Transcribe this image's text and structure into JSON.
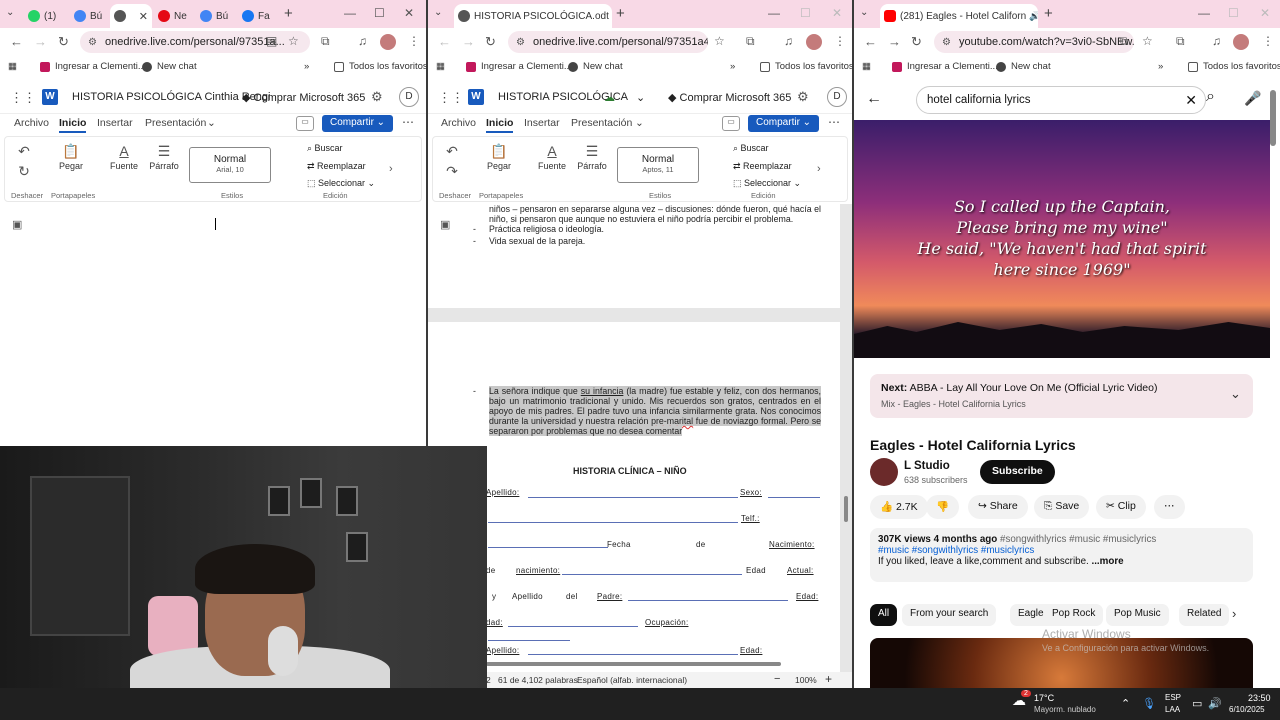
{
  "win1": {
    "tabs": [
      {
        "label": "(1)",
        "color": "#25d366"
      },
      {
        "label": "Bú",
        "color": "#4285f4"
      },
      {
        "label": "",
        "color": "#555555"
      },
      {
        "label": "Ne",
        "color": "#e50914"
      },
      {
        "label": "Bú",
        "color": "#4285f4"
      },
      {
        "label": "Fa",
        "color": "#1877f2"
      }
    ],
    "url": "onedrive.live.com/personal/97351a...",
    "bookmarks": [
      "Ingresar a Clementi...",
      "New chat",
      "Todos los favoritos"
    ],
    "doc_title": "HISTORIA PSICOLÓGICA Cinthia Rengi",
    "buy": "Comprar Microsoft 365",
    "avatar": "D",
    "ribbon_tabs": [
      "Archivo",
      "Inicio",
      "Insertar",
      "Presentación"
    ],
    "share": "Compartir",
    "undo_cap": "Deshacer",
    "paste": "Pegar",
    "clipboard_cap": "Portapapeles",
    "font": "Fuente",
    "paragraph": "Párrafo",
    "style_name": "Normal",
    "style_font": "Arial, 10",
    "styles_cap": "Estilos",
    "edit_items": [
      "Buscar",
      "Reemplazar",
      "Seleccionar"
    ],
    "edit_cap": "Edición"
  },
  "win2": {
    "tab_title": "HISTORIA PSICOLÓGICA.odt",
    "url": "onedrive.live.com/personal/97351a4aa3...",
    "bookmarks": [
      "Ingresar a Clementi...",
      "New chat",
      "Todos los favoritos"
    ],
    "doc_title": "HISTORIA PSICOLÓGICA",
    "buy": "Comprar Microsoft 365",
    "avatar": "D",
    "ribbon_tabs": [
      "Archivo",
      "Inicio",
      "Insertar",
      "Presentación"
    ],
    "share": "Compartir",
    "undo_cap": "Deshacer",
    "paste": "Pegar",
    "clipboard_cap": "Portapapeles",
    "font": "Fuente",
    "paragraph": "Párrafo",
    "style_name": "Normal",
    "style_font": "Aptos, 11",
    "styles_cap": "Estilos",
    "edit_items": [
      "Buscar",
      "Reemplazar",
      "Seleccionar"
    ],
    "edit_cap": "Edición",
    "text_top": "niños – pensaron en separarse alguna vez – discusiones: dónde fueron, qué hacía el niño, si pensaron que aunque no estuviera el niño podría percibir el problema.",
    "bullet1": "Práctica religiosa o ideología.",
    "bullet2": "Vida sexual de la pareja.",
    "para_a": "La señora indique que ",
    "para_b": "su infancia",
    "para_c": " (la madre) fue estable y feliz, con dos hermanos, bajo un matrimonio tradicional y unido. Mis recuerdos son gratos, centrados en el apoyo de mis padres. El padre tuvo una infancia similarmente grata. Nos conocimos durante la universidad y nuestra relación ",
    "para_d": "pre-marital",
    "para_e": " fue de noviazgo formal. Pero se separaron por problemas que no desea comentar",
    "hist_title": "HISTORIA CLÍNICA – NIÑO",
    "form": {
      "apellido": "Apellido:",
      "sexo": "Sexo:",
      "telf": "Telf.:",
      "fecha": "Fecha",
      "de": "de",
      "nacimiento": "Nacimiento:",
      "de2": "de",
      "nacimiento2": "nacimiento:",
      "edad": "Edad",
      "actual": "Actual:",
      "y": "y",
      "apellido2": "Apellido",
      "del": "del",
      "padre": "Padre:",
      "edad2": "Edad:",
      "dad": "dad:",
      "ocupacion": "Ocupación:",
      "apellido3": "Apellido:",
      "edad3": "Edad:"
    },
    "status_words": "61 de 4,102 palabras",
    "status_lang": "Español (alfab. internacional)",
    "status_page": "2",
    "zoom": "100%"
  },
  "win3": {
    "tab_title": "(281) Eagles - Hotel Californ",
    "url": "youtube.com/watch?v=3vi0-SbNEw...",
    "bookmarks": [
      "Ingresar a Clementi...",
      "New chat",
      "Todos los favoritos"
    ],
    "search": "hotel california lyrics",
    "lyrics": [
      "So I called up the Captain,",
      "Please bring me my wine\"",
      "He said, \"We haven't had that spirit",
      "here since 1969\""
    ],
    "next_label": "Next:",
    "next_title": "ABBA - Lay All Your Love On Me (Official Lyric Video)",
    "next_sub": "Mix - Eagles - Hotel California Lyrics",
    "video_title": "Eagles - Hotel California Lyrics",
    "channel": "L Studio",
    "subscribers": "638 subscribers",
    "subscribe": "Subscribe",
    "likes": "2.7K",
    "share": "Share",
    "save": "Save",
    "clip": "Clip",
    "views": "307K views",
    "age": "4 months ago",
    "tags_inline": "#songwithlyrics #music #musiclyrics",
    "tags_line": "#music #songwithlyrics #musiclyrics",
    "desc_text": "If you liked, leave a like,comment and subscribe.",
    "more": "...more",
    "chips": [
      "All",
      "From your search",
      "Eagles",
      "Pop Rock",
      "Pop Music",
      "Related"
    ],
    "activate": "Activar Windows",
    "activate_sub": "Ve a Configuración para activar Windows."
  },
  "taskbar": {
    "weather_temp": "17°C",
    "weather_desc": "Mayorm. nublado",
    "notif_count": "2",
    "lang1": "ESP",
    "lang2": "LAA",
    "time": "23:50",
    "date": "6/10/2025"
  },
  "colors": {
    "tabstrip": "#f8d9e6",
    "word_blue": "#185abd",
    "yt_red": "#ff0000"
  }
}
